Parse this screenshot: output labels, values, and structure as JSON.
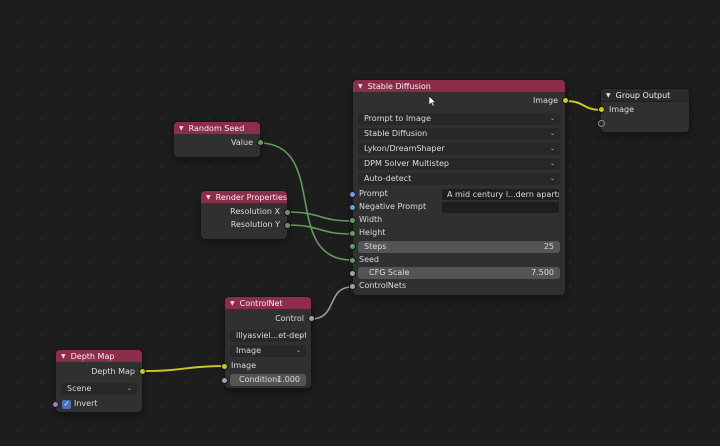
{
  "nodes": {
    "stable_diffusion": {
      "title": "Stable Diffusion",
      "output_image": "Image",
      "dropdowns": [
        "Prompt to Image",
        "Stable Diffusion",
        "Lykon/DreamShaper",
        "DPM Solver Multistep",
        "Auto-detect"
      ],
      "prompt_label": "Prompt",
      "prompt_value": "A mid century l...dern apartment",
      "negative_prompt_label": "Negative Prompt",
      "negative_prompt_value": "",
      "width_label": "Width",
      "height_label": "Height",
      "steps_label": "Steps",
      "steps_value": "25",
      "seed_label": "Seed",
      "cfg_label": "CFG Scale",
      "cfg_value": "7.500",
      "controlnets_label": "ControlNets"
    },
    "group_output": {
      "title": "Group Output",
      "input_image": "Image"
    },
    "random_seed": {
      "title": "Random Seed",
      "output_value": "Value"
    },
    "render_properties": {
      "title": "Render Properties",
      "resolution_x": "Resolution X",
      "resolution_y": "Resolution Y"
    },
    "controlnet": {
      "title": "ControlNet",
      "output_control": "Control",
      "model_dropdown": "lllyasviel...et-depth",
      "image_dropdown": "Image",
      "input_image": "Image",
      "conditioning_label": "Conditioni",
      "conditioning_value": "1.000"
    },
    "depth_map": {
      "title": "Depth Map",
      "output_depth_map": "Depth Map",
      "scene_dropdown": "Scene",
      "invert_label": "Invert",
      "invert_checked": true
    }
  },
  "colors": {
    "node_header": "#8c2e4a",
    "node_body": "#303030",
    "socket_image": "#c7c729",
    "socket_float": "#639c63",
    "socket_shader": "#a1a1a1",
    "socket_string": "#6ca0e6",
    "socket_bool": "#9b7fcf",
    "link_green": "#5f9a5f",
    "link_yellow": "#c8c82a",
    "link_gray": "#9a9a9a"
  }
}
